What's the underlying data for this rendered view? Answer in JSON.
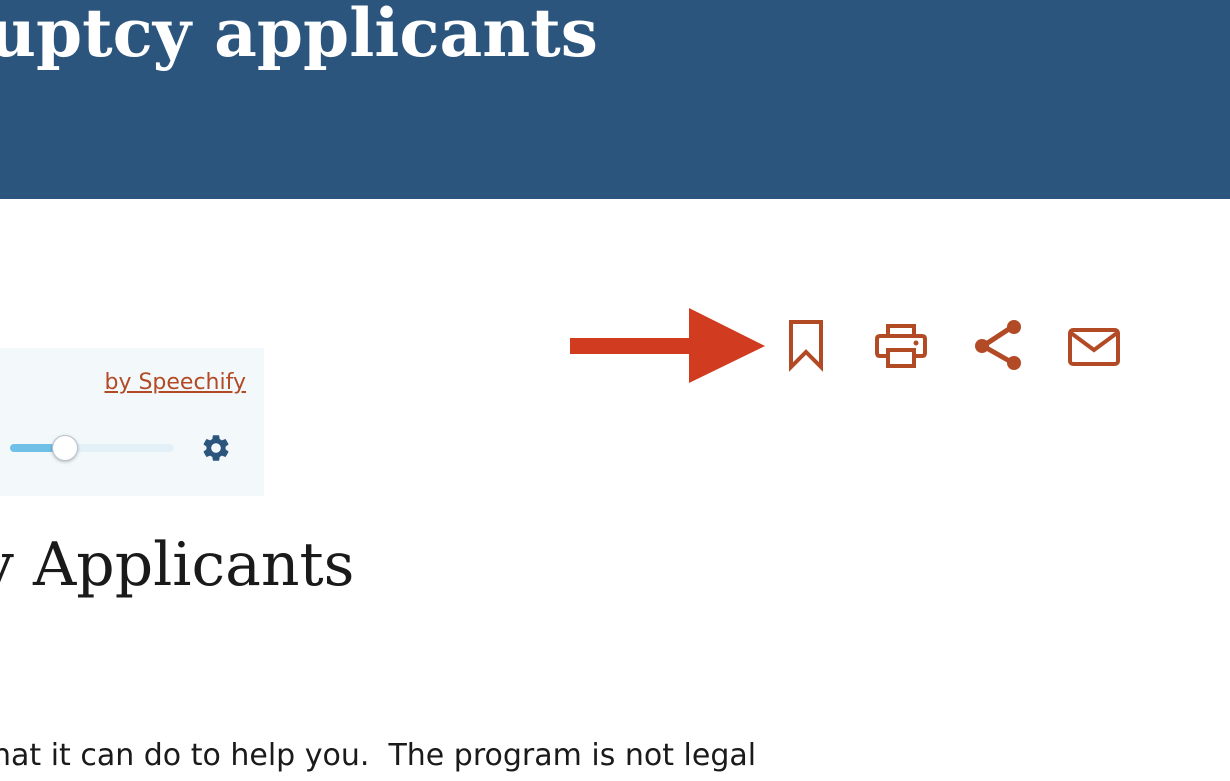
{
  "banner": {
    "title": "uptcy applicants",
    "background_color": "#2c557e"
  },
  "speech_widget": {
    "powered_by": "by Speechify",
    "speed_slider_value_percent": 33,
    "settings_icon": "gear-icon"
  },
  "toolbar": {
    "items": [
      {
        "icon": "bookmark-icon",
        "label": "Bookmark"
      },
      {
        "icon": "printer-icon",
        "label": "Print"
      },
      {
        "icon": "share-icon",
        "label": "Share"
      },
      {
        "icon": "mail-icon",
        "label": "Email"
      }
    ],
    "icon_color": "#b34a26"
  },
  "annotation": {
    "arrow_icon": "arrow-right-icon",
    "arrow_color": "#d13b20"
  },
  "content": {
    "heading": "y Applicants",
    "paragraph": "hat it can do to help you.  The program is not legal"
  }
}
